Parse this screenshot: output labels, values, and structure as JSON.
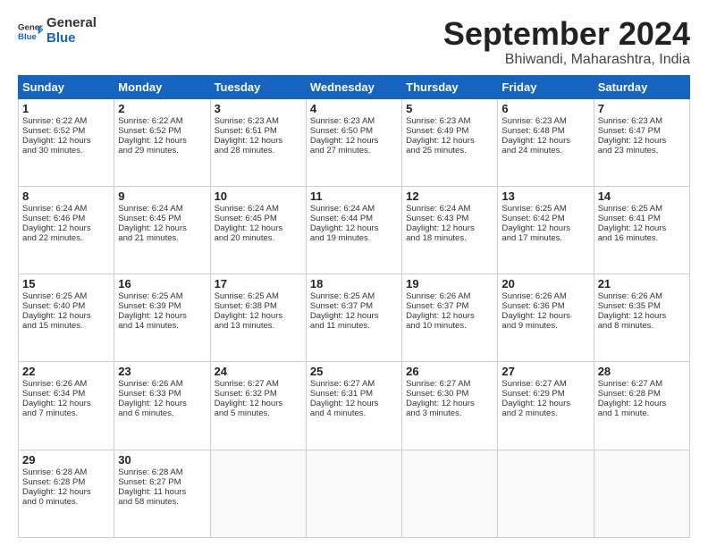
{
  "header": {
    "logo_line1": "General",
    "logo_line2": "Blue",
    "month": "September 2024",
    "location": "Bhiwandi, Maharashtra, India"
  },
  "weekdays": [
    "Sunday",
    "Monday",
    "Tuesday",
    "Wednesday",
    "Thursday",
    "Friday",
    "Saturday"
  ],
  "weeks": [
    [
      {
        "day": "1",
        "lines": [
          "Sunrise: 6:22 AM",
          "Sunset: 6:52 PM",
          "Daylight: 12 hours",
          "and 30 minutes."
        ]
      },
      {
        "day": "2",
        "lines": [
          "Sunrise: 6:22 AM",
          "Sunset: 6:52 PM",
          "Daylight: 12 hours",
          "and 29 minutes."
        ]
      },
      {
        "day": "3",
        "lines": [
          "Sunrise: 6:23 AM",
          "Sunset: 6:51 PM",
          "Daylight: 12 hours",
          "and 28 minutes."
        ]
      },
      {
        "day": "4",
        "lines": [
          "Sunrise: 6:23 AM",
          "Sunset: 6:50 PM",
          "Daylight: 12 hours",
          "and 27 minutes."
        ]
      },
      {
        "day": "5",
        "lines": [
          "Sunrise: 6:23 AM",
          "Sunset: 6:49 PM",
          "Daylight: 12 hours",
          "and 25 minutes."
        ]
      },
      {
        "day": "6",
        "lines": [
          "Sunrise: 6:23 AM",
          "Sunset: 6:48 PM",
          "Daylight: 12 hours",
          "and 24 minutes."
        ]
      },
      {
        "day": "7",
        "lines": [
          "Sunrise: 6:23 AM",
          "Sunset: 6:47 PM",
          "Daylight: 12 hours",
          "and 23 minutes."
        ]
      }
    ],
    [
      {
        "day": "8",
        "lines": [
          "Sunrise: 6:24 AM",
          "Sunset: 6:46 PM",
          "Daylight: 12 hours",
          "and 22 minutes."
        ]
      },
      {
        "day": "9",
        "lines": [
          "Sunrise: 6:24 AM",
          "Sunset: 6:45 PM",
          "Daylight: 12 hours",
          "and 21 minutes."
        ]
      },
      {
        "day": "10",
        "lines": [
          "Sunrise: 6:24 AM",
          "Sunset: 6:45 PM",
          "Daylight: 12 hours",
          "and 20 minutes."
        ]
      },
      {
        "day": "11",
        "lines": [
          "Sunrise: 6:24 AM",
          "Sunset: 6:44 PM",
          "Daylight: 12 hours",
          "and 19 minutes."
        ]
      },
      {
        "day": "12",
        "lines": [
          "Sunrise: 6:24 AM",
          "Sunset: 6:43 PM",
          "Daylight: 12 hours",
          "and 18 minutes."
        ]
      },
      {
        "day": "13",
        "lines": [
          "Sunrise: 6:25 AM",
          "Sunset: 6:42 PM",
          "Daylight: 12 hours",
          "and 17 minutes."
        ]
      },
      {
        "day": "14",
        "lines": [
          "Sunrise: 6:25 AM",
          "Sunset: 6:41 PM",
          "Daylight: 12 hours",
          "and 16 minutes."
        ]
      }
    ],
    [
      {
        "day": "15",
        "lines": [
          "Sunrise: 6:25 AM",
          "Sunset: 6:40 PM",
          "Daylight: 12 hours",
          "and 15 minutes."
        ]
      },
      {
        "day": "16",
        "lines": [
          "Sunrise: 6:25 AM",
          "Sunset: 6:39 PM",
          "Daylight: 12 hours",
          "and 14 minutes."
        ]
      },
      {
        "day": "17",
        "lines": [
          "Sunrise: 6:25 AM",
          "Sunset: 6:38 PM",
          "Daylight: 12 hours",
          "and 13 minutes."
        ]
      },
      {
        "day": "18",
        "lines": [
          "Sunrise: 6:25 AM",
          "Sunset: 6:37 PM",
          "Daylight: 12 hours",
          "and 11 minutes."
        ]
      },
      {
        "day": "19",
        "lines": [
          "Sunrise: 6:26 AM",
          "Sunset: 6:37 PM",
          "Daylight: 12 hours",
          "and 10 minutes."
        ]
      },
      {
        "day": "20",
        "lines": [
          "Sunrise: 6:26 AM",
          "Sunset: 6:36 PM",
          "Daylight: 12 hours",
          "and 9 minutes."
        ]
      },
      {
        "day": "21",
        "lines": [
          "Sunrise: 6:26 AM",
          "Sunset: 6:35 PM",
          "Daylight: 12 hours",
          "and 8 minutes."
        ]
      }
    ],
    [
      {
        "day": "22",
        "lines": [
          "Sunrise: 6:26 AM",
          "Sunset: 6:34 PM",
          "Daylight: 12 hours",
          "and 7 minutes."
        ]
      },
      {
        "day": "23",
        "lines": [
          "Sunrise: 6:26 AM",
          "Sunset: 6:33 PM",
          "Daylight: 12 hours",
          "and 6 minutes."
        ]
      },
      {
        "day": "24",
        "lines": [
          "Sunrise: 6:27 AM",
          "Sunset: 6:32 PM",
          "Daylight: 12 hours",
          "and 5 minutes."
        ]
      },
      {
        "day": "25",
        "lines": [
          "Sunrise: 6:27 AM",
          "Sunset: 6:31 PM",
          "Daylight: 12 hours",
          "and 4 minutes."
        ]
      },
      {
        "day": "26",
        "lines": [
          "Sunrise: 6:27 AM",
          "Sunset: 6:30 PM",
          "Daylight: 12 hours",
          "and 3 minutes."
        ]
      },
      {
        "day": "27",
        "lines": [
          "Sunrise: 6:27 AM",
          "Sunset: 6:29 PM",
          "Daylight: 12 hours",
          "and 2 minutes."
        ]
      },
      {
        "day": "28",
        "lines": [
          "Sunrise: 6:27 AM",
          "Sunset: 6:28 PM",
          "Daylight: 12 hours",
          "and 1 minute."
        ]
      }
    ],
    [
      {
        "day": "29",
        "lines": [
          "Sunrise: 6:28 AM",
          "Sunset: 6:28 PM",
          "Daylight: 12 hours",
          "and 0 minutes."
        ]
      },
      {
        "day": "30",
        "lines": [
          "Sunrise: 6:28 AM",
          "Sunset: 6:27 PM",
          "Daylight: 11 hours",
          "and 58 minutes."
        ]
      },
      {
        "day": "",
        "lines": []
      },
      {
        "day": "",
        "lines": []
      },
      {
        "day": "",
        "lines": []
      },
      {
        "day": "",
        "lines": []
      },
      {
        "day": "",
        "lines": []
      }
    ]
  ]
}
